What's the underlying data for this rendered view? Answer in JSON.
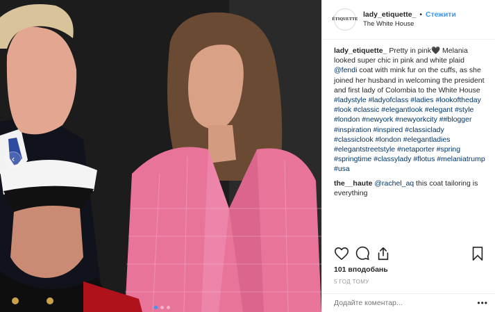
{
  "header": {
    "avatar_text": "ÉTIQUETTE",
    "username": "lady_etiquette_",
    "separator": "•",
    "follow_label": "Стежити",
    "location": "The White House"
  },
  "caption": {
    "username": "lady_etiquette_",
    "text_before_mention": "Pretty in pink🖤 Melania looked super chic in pink and white plaid ",
    "mention": "@fendi",
    "text_after_mention": " coat with mink fur on the cuffs, as she joined her husband in welcoming the president and first lady of Colombia to the White House ",
    "hashtags": "#ladystyle #ladyofclass #ladies #lookoftheday #look #classic #elegantlook #elegant #style #london #newyork #newyorkcity ##blogger #inspiration #inspired #classiclady #classiclook #london #elegantladies #elegantstreetstyle #netaporter #spring #springtime #classylady #flotus #melaniatrump #usa"
  },
  "comment": {
    "username": "the__haute",
    "mention": "@rachel_aq",
    "text": " this coat tailoring is everything"
  },
  "likes": "101 вподобань",
  "timestamp": "5 ГОД ТОМУ",
  "add_comment_placeholder": "Додайте коментар...",
  "more_label": "•••",
  "carousel": {
    "prev_label": "‹",
    "slide_count": 3,
    "active_index": 0
  },
  "icons": {
    "like": "heart-icon",
    "comment": "comment-icon",
    "share": "share-icon",
    "save": "bookmark-icon"
  },
  "colors": {
    "link": "#3897f0",
    "hashtag": "#003569",
    "text": "#262626",
    "muted": "#999999",
    "coat_pink": "#e8749a"
  }
}
